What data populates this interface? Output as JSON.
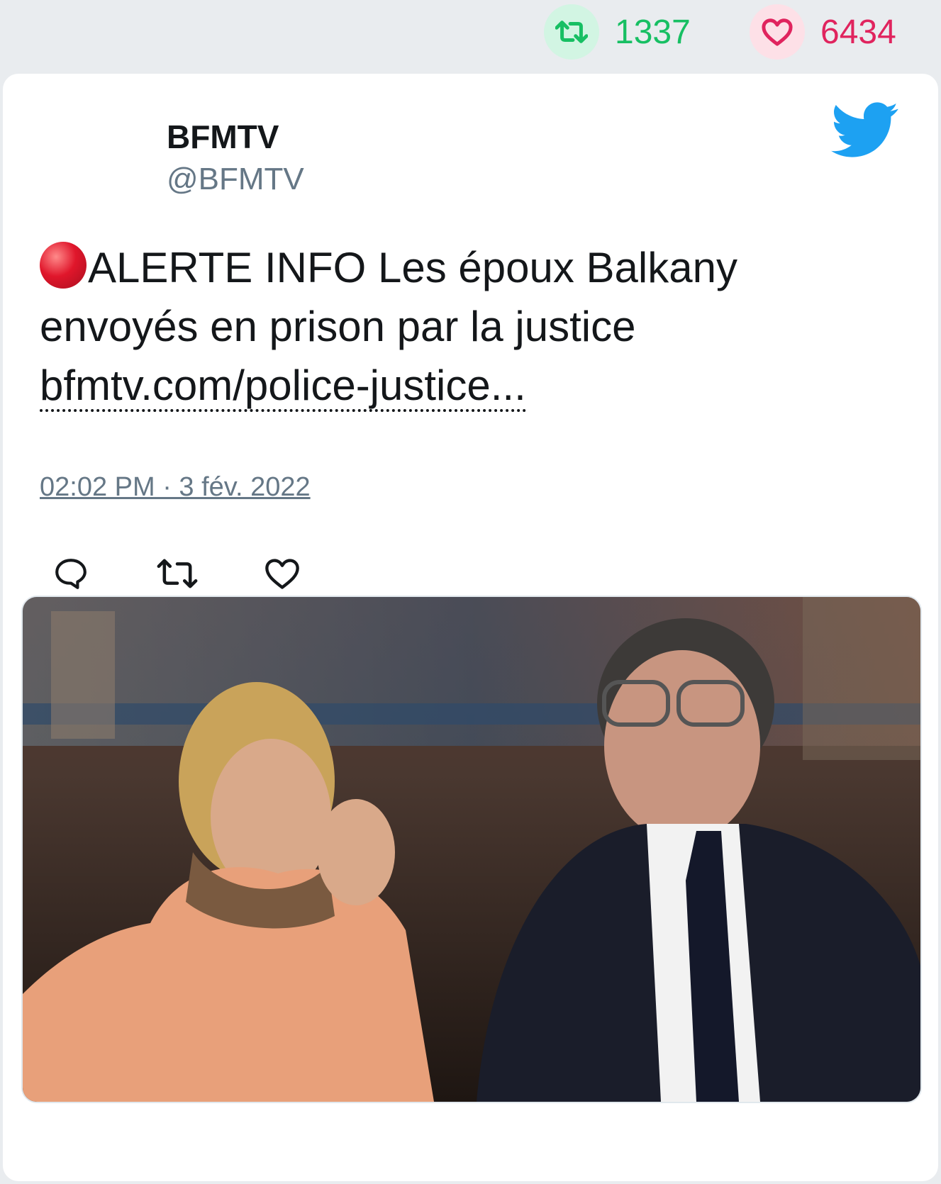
{
  "stats": {
    "retweet_count": "1337",
    "like_count": "6434",
    "retweet_icon": "retweet-icon",
    "like_icon": "heart-icon"
  },
  "tweet": {
    "author_name": "BFMTV",
    "author_handle": "@BFMTV",
    "text": "ALERTE INFO Les époux Balkany envoyés en prison par la justice",
    "alert_icon": "red-circle-emoji",
    "link_text": "bfmtv.com/police-justice...",
    "timestamp": "02:02 PM · 3 fév. 2022"
  },
  "actions": [
    "reply-icon",
    "retweet-icon",
    "heart-icon"
  ],
  "colors": {
    "retweet": "#17bf63",
    "like": "#e0245e",
    "twitter_blue": "#1da1f2",
    "handle_gray": "#657786"
  }
}
